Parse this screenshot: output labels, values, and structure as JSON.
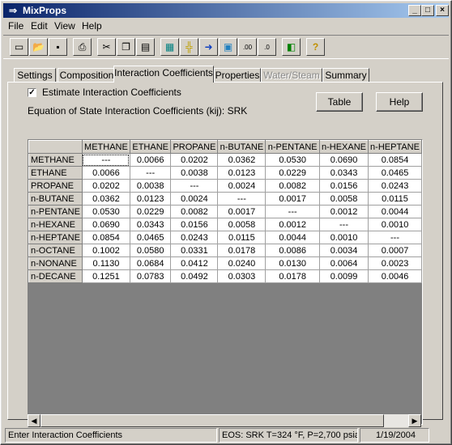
{
  "window": {
    "title": "MixProps"
  },
  "menu": {
    "file": "File",
    "edit": "Edit",
    "view": "View",
    "help": "Help"
  },
  "toolbar": {
    "buttons": [
      "new-icon",
      "open-icon",
      "save-icon",
      "print-icon",
      "cut-icon",
      "copy-icon",
      "paste-icon",
      "calculator-icon",
      "crosshair-icon",
      "arrow-right-icon",
      "data-icon",
      "decimal-increase-icon",
      "decimal-decrease-icon",
      "export-icon",
      "help-icon"
    ]
  },
  "tabs": [
    {
      "label": "Settings",
      "state": "normal"
    },
    {
      "label": "Composition",
      "state": "normal"
    },
    {
      "label": "Interaction Coefficients",
      "state": "active"
    },
    {
      "label": "Properties",
      "state": "normal"
    },
    {
      "label": "Water/Steam",
      "state": "disabled"
    },
    {
      "label": "Summary",
      "state": "normal"
    }
  ],
  "panel": {
    "estimate_label": "Estimate Interaction Coefficients",
    "estimate_checked": true,
    "eos_label": "Equation of State Interaction Coefficients (kij):  SRK",
    "table_button": "Table",
    "help_button": "Help"
  },
  "grid": {
    "columns": [
      "METHANE",
      "ETHANE",
      "PROPANE",
      "n-BUTANE",
      "n-PENTANE",
      "n-HEXANE",
      "n-HEPTANE"
    ],
    "rows": [
      {
        "name": "METHANE",
        "values": [
          "---",
          "0.0066",
          "0.0202",
          "0.0362",
          "0.0530",
          "0.0690",
          "0.0854"
        ]
      },
      {
        "name": "ETHANE",
        "values": [
          "0.0066",
          "---",
          "0.0038",
          "0.0123",
          "0.0229",
          "0.0343",
          "0.0465"
        ]
      },
      {
        "name": "PROPANE",
        "values": [
          "0.0202",
          "0.0038",
          "---",
          "0.0024",
          "0.0082",
          "0.0156",
          "0.0243"
        ]
      },
      {
        "name": "n-BUTANE",
        "values": [
          "0.0362",
          "0.0123",
          "0.0024",
          "---",
          "0.0017",
          "0.0058",
          "0.0115"
        ]
      },
      {
        "name": "n-PENTANE",
        "values": [
          "0.0530",
          "0.0229",
          "0.0082",
          "0.0017",
          "---",
          "0.0012",
          "0.0044"
        ]
      },
      {
        "name": "n-HEXANE",
        "values": [
          "0.0690",
          "0.0343",
          "0.0156",
          "0.0058",
          "0.0012",
          "---",
          "0.0010"
        ]
      },
      {
        "name": "n-HEPTANE",
        "values": [
          "0.0854",
          "0.0465",
          "0.0243",
          "0.0115",
          "0.0044",
          "0.0010",
          "---"
        ]
      },
      {
        "name": "n-OCTANE",
        "values": [
          "0.1002",
          "0.0580",
          "0.0331",
          "0.0178",
          "0.0086",
          "0.0034",
          "0.0007"
        ]
      },
      {
        "name": "n-NONANE",
        "values": [
          "0.1130",
          "0.0684",
          "0.0412",
          "0.0240",
          "0.0130",
          "0.0064",
          "0.0023"
        ]
      },
      {
        "name": "n-DECANE",
        "values": [
          "0.1251",
          "0.0783",
          "0.0492",
          "0.0303",
          "0.0178",
          "0.0099",
          "0.0046"
        ]
      }
    ]
  },
  "status": {
    "message": "Enter Interaction Coefficients",
    "eos": "EOS: SRK  T=324 °F, P=2,700 psia",
    "date": "1/19/2004"
  }
}
